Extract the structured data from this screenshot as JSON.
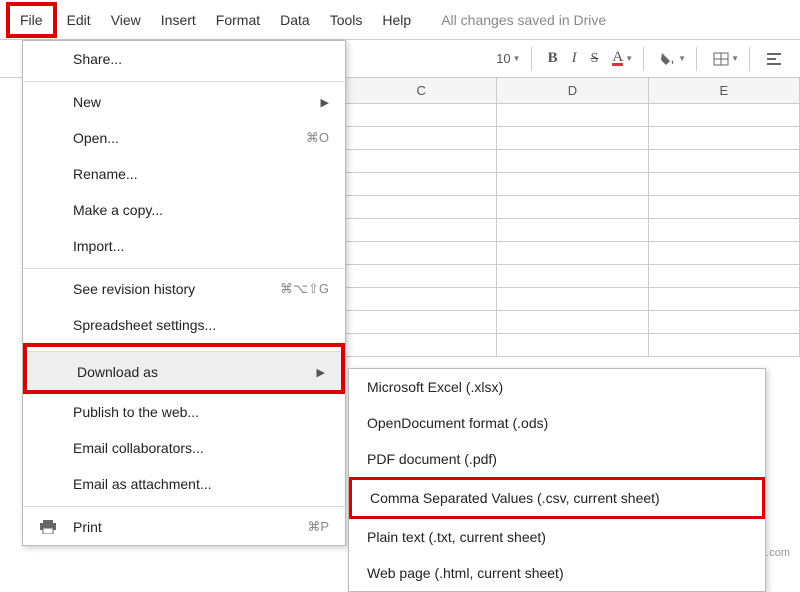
{
  "menubar": {
    "items": [
      "File",
      "Edit",
      "View",
      "Insert",
      "Format",
      "Data",
      "Tools",
      "Help"
    ],
    "status": "All changes saved in Drive"
  },
  "toolbar": {
    "font_size": "10",
    "bold": "B",
    "italic": "I",
    "strike": "S",
    "text_color": "A"
  },
  "columns": [
    "C",
    "D",
    "E"
  ],
  "file_menu": {
    "share": "Share...",
    "new": "New",
    "open": "Open...",
    "open_shortcut": "⌘O",
    "rename": "Rename...",
    "make_copy": "Make a copy...",
    "import": "Import...",
    "revision": "See revision history",
    "revision_shortcut": "⌘⌥⇧G",
    "settings": "Spreadsheet settings...",
    "download": "Download as",
    "publish": "Publish to the web...",
    "email_collab": "Email collaborators...",
    "email_attach": "Email as attachment...",
    "print": "Print",
    "print_shortcut": "⌘P"
  },
  "download_submenu": {
    "xlsx": "Microsoft Excel (.xlsx)",
    "ods": "OpenDocument format (.ods)",
    "pdf": "PDF document (.pdf)",
    "csv": "Comma Separated Values (.csv, current sheet)",
    "txt": "Plain text (.txt, current sheet)",
    "html": "Web page (.html, current sheet)"
  },
  "footer": "wsxdn.com"
}
